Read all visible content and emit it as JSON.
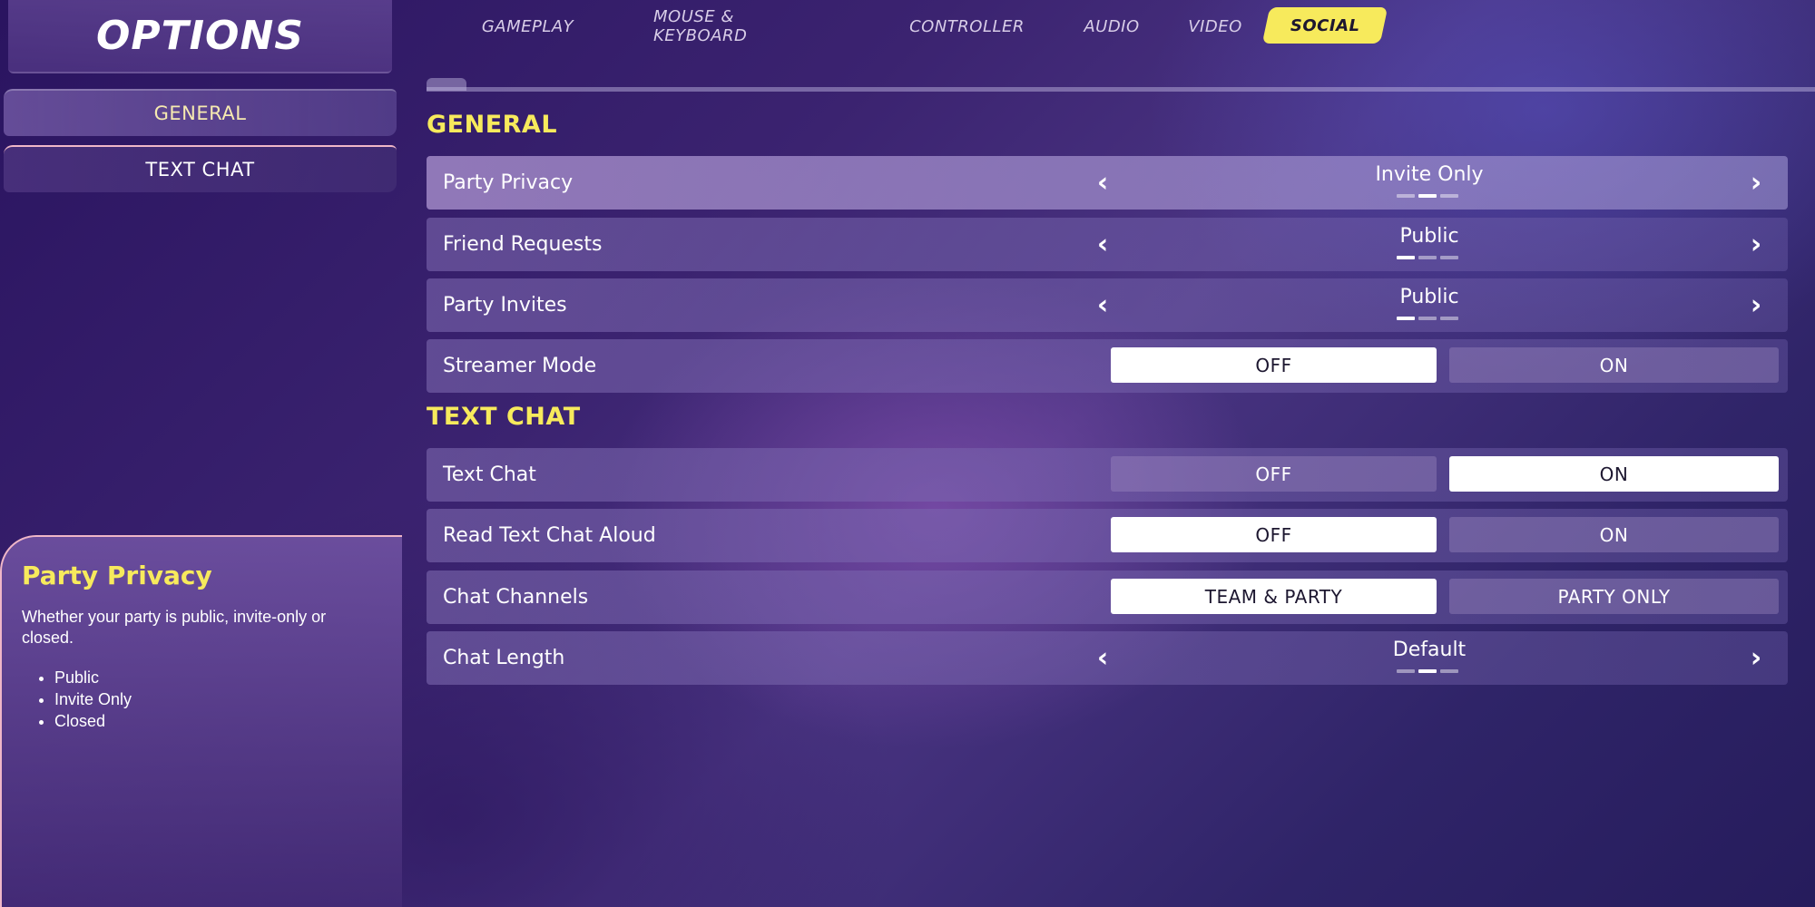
{
  "header": {
    "title": "OPTIONS",
    "tabs": [
      "GAMEPLAY",
      "MOUSE & KEYBOARD",
      "CONTROLLER",
      "AUDIO",
      "VIDEO",
      "SOCIAL"
    ],
    "active_tab": "SOCIAL"
  },
  "sidebar": {
    "items": [
      "GENERAL",
      "TEXT CHAT"
    ]
  },
  "info": {
    "title": "Party Privacy",
    "description": "Whether your party is public, invite-only or closed.",
    "options": [
      "Public",
      "Invite Only",
      "Closed"
    ]
  },
  "sections": {
    "general": {
      "title": "GENERAL",
      "party_privacy": {
        "label": "Party Privacy",
        "value": "Invite Only",
        "index": 2,
        "count": 3
      },
      "friend_requests": {
        "label": "Friend Requests",
        "value": "Public",
        "index": 1,
        "count": 3
      },
      "party_invites": {
        "label": "Party Invites",
        "value": "Public",
        "index": 1,
        "count": 3
      },
      "streamer_mode": {
        "label": "Streamer Mode",
        "option1": "OFF",
        "option2": "ON",
        "selected": "OFF"
      }
    },
    "text_chat": {
      "title": "TEXT CHAT",
      "text_chat": {
        "label": "Text Chat",
        "option1": "OFF",
        "option2": "ON",
        "selected": "ON"
      },
      "read_aloud": {
        "label": "Read Text Chat Aloud",
        "option1": "OFF",
        "option2": "ON",
        "selected": "OFF"
      },
      "chat_channels": {
        "label": "Chat Channels",
        "option1": "TEAM & PARTY",
        "option2": "PARTY ONLY",
        "selected": "TEAM & PARTY"
      },
      "chat_length": {
        "label": "Chat Length",
        "value": "Default",
        "index": 2,
        "count": 3
      }
    }
  },
  "colors": {
    "accent": "#f7ea5c",
    "panel_border": "#f0b7c8",
    "background": "#3b2370"
  },
  "icons": {
    "left_arrow": "chevron-left-icon",
    "right_arrow": "chevron-right-icon"
  }
}
